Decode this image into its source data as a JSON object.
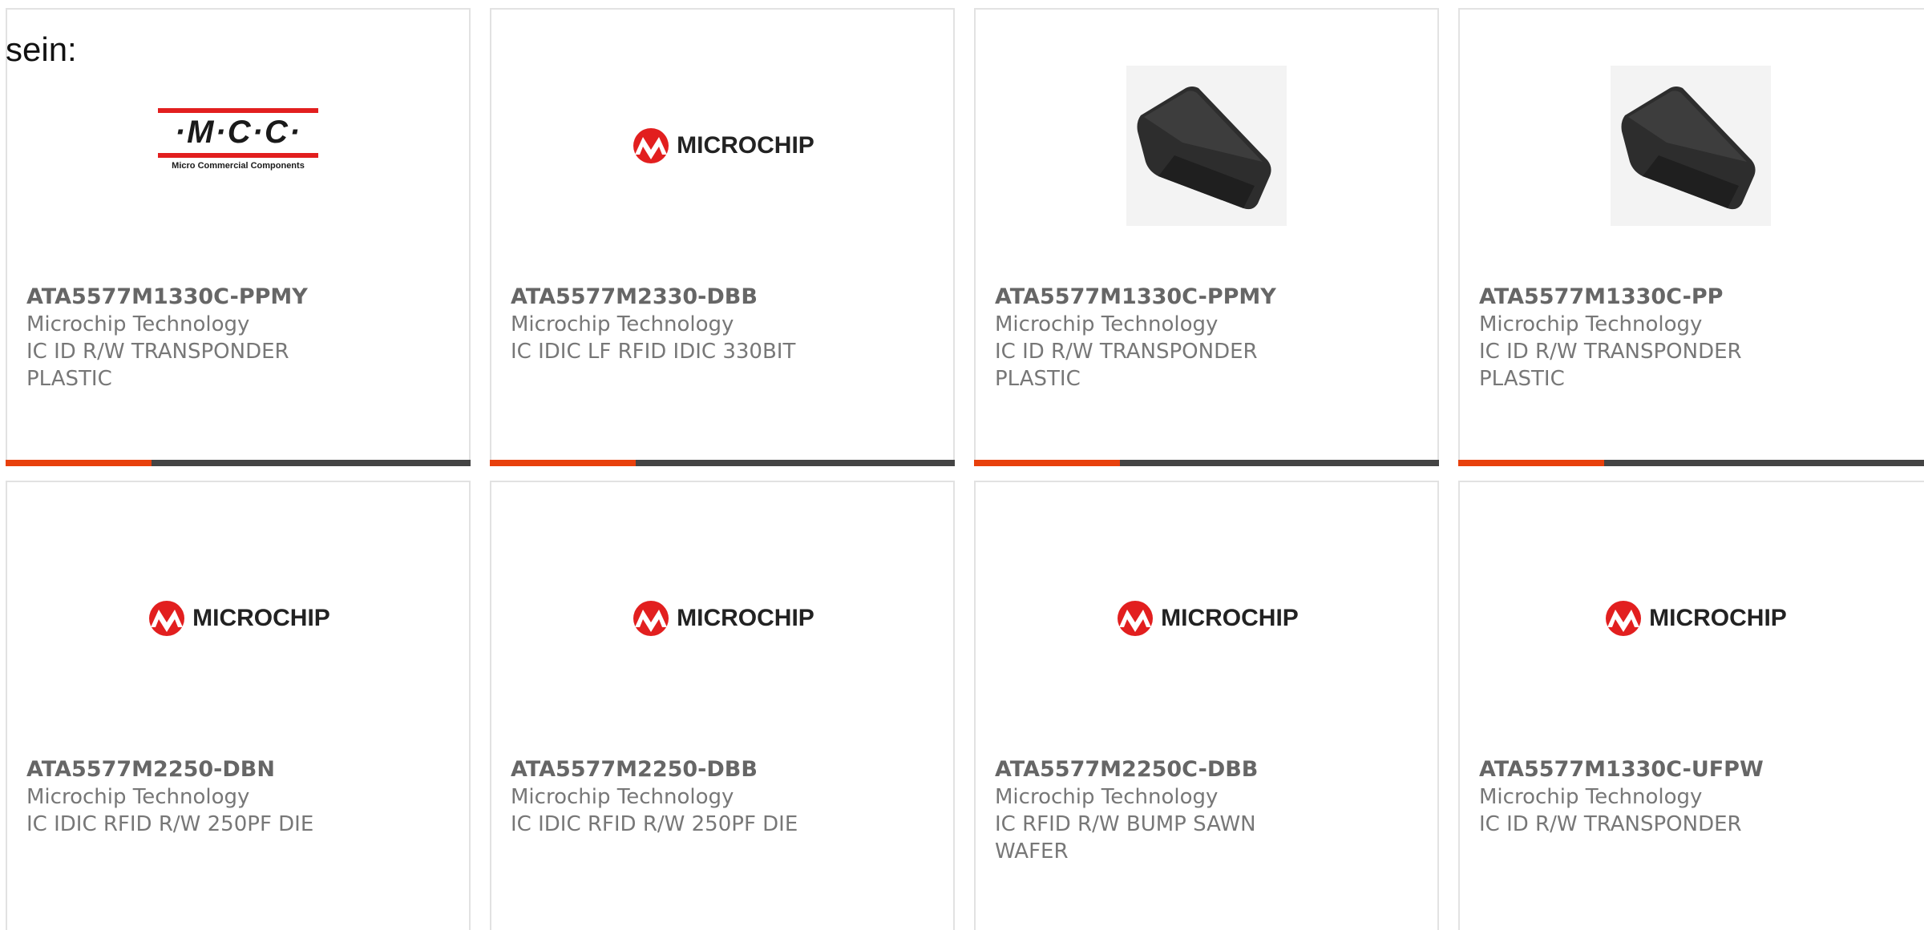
{
  "intro_text": "sein:",
  "colors": {
    "accent": "#e8400c",
    "bar": "#444444",
    "border": "#e2e2e2",
    "microchip_red": "#e21f1f"
  },
  "products": [
    {
      "part_number": "ATA5577M1330C-PPMY",
      "manufacturer": "Microchip Technology",
      "description": "IC ID R/W TRANSPONDER PLASTIC",
      "image": "mcc-logo",
      "logo_letters": "·M·C·C·",
      "logo_sub": "Micro Commercial Components"
    },
    {
      "part_number": "ATA5577M2330-DBB",
      "manufacturer": "Microchip Technology",
      "description": "IC IDIC LF RFID IDIC 330BIT",
      "image": "microchip-logo",
      "logo_text": "MICROCHIP"
    },
    {
      "part_number": "ATA5577M1330C-PPMY",
      "manufacturer": "Microchip Technology",
      "description": "IC ID R/W TRANSPONDER PLASTIC",
      "image": "transponder-photo"
    },
    {
      "part_number": "ATA5577M1330C-PP",
      "manufacturer": "Microchip Technology",
      "description": "IC ID R/W TRANSPONDER PLASTIC",
      "image": "transponder-photo"
    },
    {
      "part_number": "ATA5577M2250-DBN",
      "manufacturer": "Microchip Technology",
      "description": "IC IDIC RFID R/W 250PF DIE",
      "image": "microchip-logo",
      "logo_text": "MICROCHIP"
    },
    {
      "part_number": "ATA5577M2250-DBB",
      "manufacturer": "Microchip Technology",
      "description": "IC IDIC RFID R/W 250PF DIE",
      "image": "microchip-logo",
      "logo_text": "MICROCHIP"
    },
    {
      "part_number": "ATA5577M2250C-DBB",
      "manufacturer": "Microchip Technology",
      "description": "IC RFID R/W BUMP SAWN WAFER",
      "image": "microchip-logo",
      "logo_text": "MICROCHIP"
    },
    {
      "part_number": "ATA5577M1330C-UFPW",
      "manufacturer": "Microchip Technology",
      "description": "IC ID R/W TRANSPONDER",
      "image": "microchip-logo",
      "logo_text": "MICROCHIP"
    }
  ]
}
